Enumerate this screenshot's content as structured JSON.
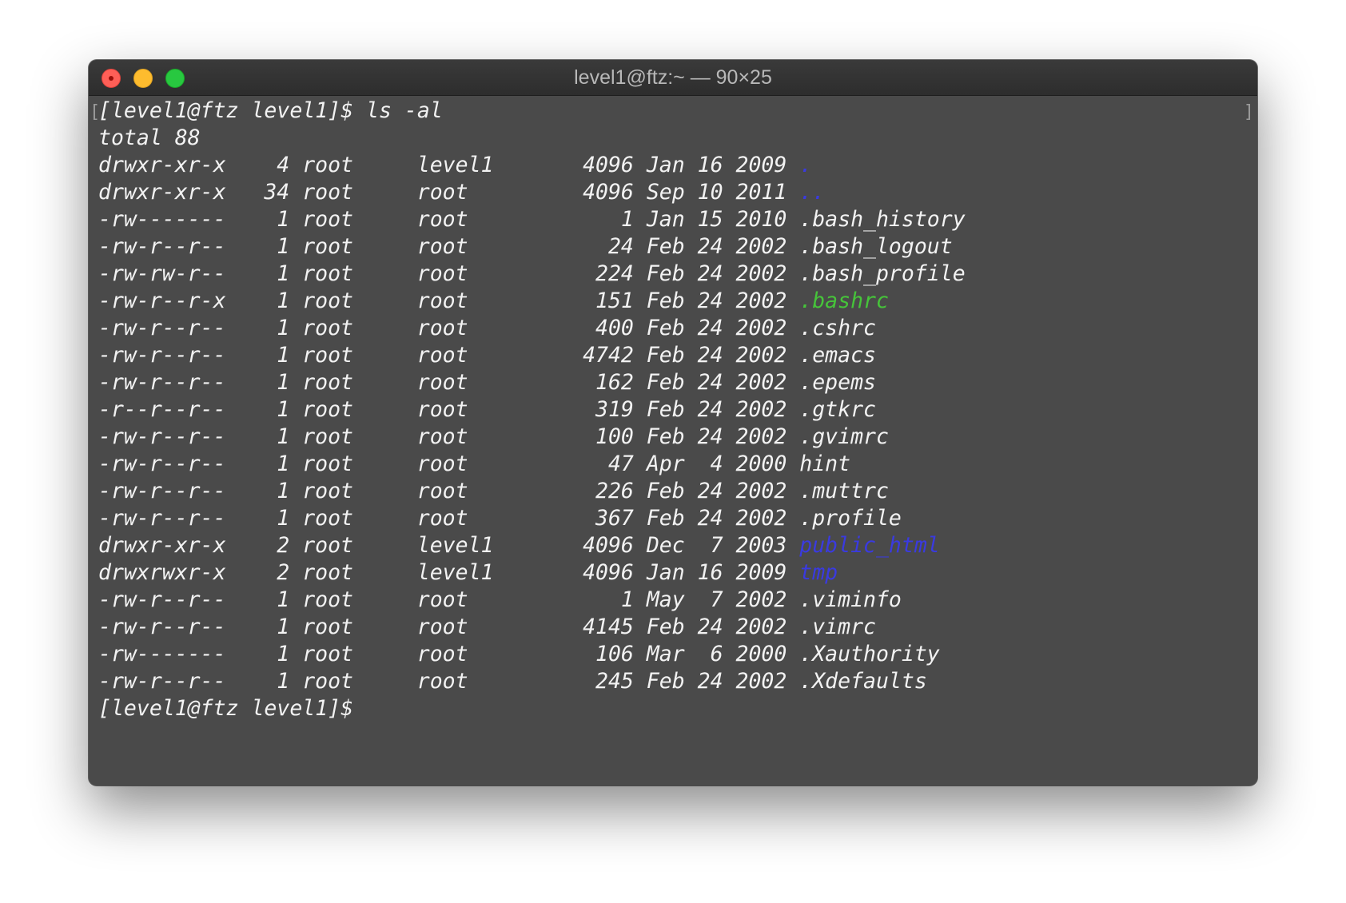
{
  "window": {
    "title": "level1@ftz:~ — 90×25"
  },
  "terminal": {
    "command_line": "[level1@ftz level1]$ ls -al",
    "total_line": "total 88",
    "listing": [
      {
        "perms": "drwxr-xr-x",
        "links": "4",
        "owner": "root",
        "group": "level1",
        "size": "4096",
        "month": "Jan",
        "day": "16",
        "year": "2009",
        "name": ".",
        "color": "#3a3ae0"
      },
      {
        "perms": "drwxr-xr-x",
        "links": "34",
        "owner": "root",
        "group": "root",
        "size": "4096",
        "month": "Sep",
        "day": "10",
        "year": "2011",
        "name": "..",
        "color": "#3a3ae0"
      },
      {
        "perms": "-rw-------",
        "links": "1",
        "owner": "root",
        "group": "root",
        "size": "1",
        "month": "Jan",
        "day": "15",
        "year": "2010",
        "name": ".bash_history",
        "color": "#f2f2f2"
      },
      {
        "perms": "-rw-r--r--",
        "links": "1",
        "owner": "root",
        "group": "root",
        "size": "24",
        "month": "Feb",
        "day": "24",
        "year": "2002",
        "name": ".bash_logout",
        "color": "#f2f2f2"
      },
      {
        "perms": "-rw-rw-r--",
        "links": "1",
        "owner": "root",
        "group": "root",
        "size": "224",
        "month": "Feb",
        "day": "24",
        "year": "2002",
        "name": ".bash_profile",
        "color": "#f2f2f2"
      },
      {
        "perms": "-rw-r--r-x",
        "links": "1",
        "owner": "root",
        "group": "root",
        "size": "151",
        "month": "Feb",
        "day": "24",
        "year": "2002",
        "name": ".bashrc",
        "color": "#46c43a"
      },
      {
        "perms": "-rw-r--r--",
        "links": "1",
        "owner": "root",
        "group": "root",
        "size": "400",
        "month": "Feb",
        "day": "24",
        "year": "2002",
        "name": ".cshrc",
        "color": "#f2f2f2"
      },
      {
        "perms": "-rw-r--r--",
        "links": "1",
        "owner": "root",
        "group": "root",
        "size": "4742",
        "month": "Feb",
        "day": "24",
        "year": "2002",
        "name": ".emacs",
        "color": "#f2f2f2"
      },
      {
        "perms": "-rw-r--r--",
        "links": "1",
        "owner": "root",
        "group": "root",
        "size": "162",
        "month": "Feb",
        "day": "24",
        "year": "2002",
        "name": ".epems",
        "color": "#f2f2f2"
      },
      {
        "perms": "-r--r--r--",
        "links": "1",
        "owner": "root",
        "group": "root",
        "size": "319",
        "month": "Feb",
        "day": "24",
        "year": "2002",
        "name": ".gtkrc",
        "color": "#f2f2f2"
      },
      {
        "perms": "-rw-r--r--",
        "links": "1",
        "owner": "root",
        "group": "root",
        "size": "100",
        "month": "Feb",
        "day": "24",
        "year": "2002",
        "name": ".gvimrc",
        "color": "#f2f2f2"
      },
      {
        "perms": "-rw-r--r--",
        "links": "1",
        "owner": "root",
        "group": "root",
        "size": "47",
        "month": "Apr",
        "day": "4",
        "year": "2000",
        "name": "hint",
        "color": "#f2f2f2"
      },
      {
        "perms": "-rw-r--r--",
        "links": "1",
        "owner": "root",
        "group": "root",
        "size": "226",
        "month": "Feb",
        "day": "24",
        "year": "2002",
        "name": ".muttrc",
        "color": "#f2f2f2"
      },
      {
        "perms": "-rw-r--r--",
        "links": "1",
        "owner": "root",
        "group": "root",
        "size": "367",
        "month": "Feb",
        "day": "24",
        "year": "2002",
        "name": ".profile",
        "color": "#f2f2f2"
      },
      {
        "perms": "drwxr-xr-x",
        "links": "2",
        "owner": "root",
        "group": "level1",
        "size": "4096",
        "month": "Dec",
        "day": "7",
        "year": "2003",
        "name": "public_html",
        "color": "#3a3ae0"
      },
      {
        "perms": "drwxrwxr-x",
        "links": "2",
        "owner": "root",
        "group": "level1",
        "size": "4096",
        "month": "Jan",
        "day": "16",
        "year": "2009",
        "name": "tmp",
        "color": "#3a3ae0"
      },
      {
        "perms": "-rw-r--r--",
        "links": "1",
        "owner": "root",
        "group": "root",
        "size": "1",
        "month": "May",
        "day": "7",
        "year": "2002",
        "name": ".viminfo",
        "color": "#f2f2f2"
      },
      {
        "perms": "-rw-r--r--",
        "links": "1",
        "owner": "root",
        "group": "root",
        "size": "4145",
        "month": "Feb",
        "day": "24",
        "year": "2002",
        "name": ".vimrc",
        "color": "#f2f2f2"
      },
      {
        "perms": "-rw-------",
        "links": "1",
        "owner": "root",
        "group": "root",
        "size": "106",
        "month": "Mar",
        "day": "6",
        "year": "2000",
        "name": ".Xauthority",
        "color": "#f2f2f2"
      },
      {
        "perms": "-rw-r--r--",
        "links": "1",
        "owner": "root",
        "group": "root",
        "size": "245",
        "month": "Feb",
        "day": "24",
        "year": "2002",
        "name": ".Xdefaults",
        "color": "#f2f2f2"
      }
    ],
    "prompt": "[level1@ftz level1]$"
  },
  "colors": {
    "directory": "#3a3ae0",
    "executable": "#46c43a",
    "text": "#f2f2f2",
    "background": "#4a4a4a"
  }
}
